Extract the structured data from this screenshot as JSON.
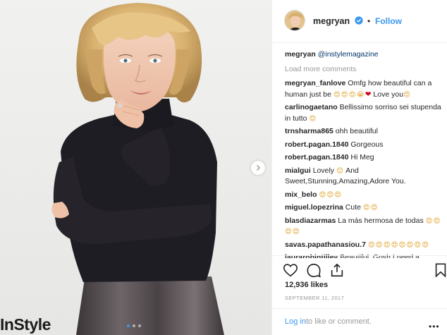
{
  "photo": {
    "watermark_text": "InStyle",
    "carousel_total": 3,
    "carousel_active": 1
  },
  "header": {
    "username": "megryan",
    "separator": "•",
    "follow_label": "Follow"
  },
  "caption": {
    "username": "megryan",
    "mention": "@instylemagazine"
  },
  "load_more_label": "Load more comments",
  "comments": [
    {
      "user": "megryan_fanlove",
      "text": "Omfg how beautiful can a human just be",
      "emoji": "😍😍😍😭",
      "heart": "❤",
      "text2": " Love you",
      "emoji2": "😍"
    },
    {
      "user": "carlinogaetano",
      "text": "Bellissimo sorriso sei stupenda in tutto",
      "emoji": "😍"
    },
    {
      "user": "trnsharma865",
      "text": "ohh beautiful"
    },
    {
      "user": "robert.pagan.1840",
      "text": "Gorgeous"
    },
    {
      "user": "robert.pagan.1840",
      "text": "Hi Meg"
    },
    {
      "user": "mialgui",
      "text": "Lovely",
      "emoji": "😊",
      "text2": " And Sweet,Stunning,Amazing,Adore You."
    },
    {
      "user": "mix_belo",
      "text": "",
      "emoji": "😍😍😍"
    },
    {
      "user": "miguel.lopezrina",
      "text": "Cute",
      "emoji": "😍😍"
    },
    {
      "user": "blasdiazarmas",
      "text": "La más hermosa de todas",
      "emoji": "😍😍😍😍"
    },
    {
      "user": "savas.papathanasiou.7",
      "text": "",
      "emoji": "😍😍😍😍😍😍😍😍"
    },
    {
      "user": "laurarobintilley",
      "text": "Beautiful. Gosh I need a"
    }
  ],
  "actions": {
    "like_icon": "heart-outline-icon",
    "comment_icon": "comment-bubble-icon",
    "share_icon": "share-icon",
    "save_icon": "bookmark-icon"
  },
  "likes_text": "12,936 likes",
  "date_text": "SEPTEMBER 11, 2017",
  "comment_bar": {
    "login_label": "Log in",
    "rest_text": "to like or comment.",
    "more_label": "•••"
  },
  "colors": {
    "link_blue": "#3897f0",
    "mention_navy": "#003569",
    "muted_gray": "#999999",
    "border": "#efefef"
  }
}
